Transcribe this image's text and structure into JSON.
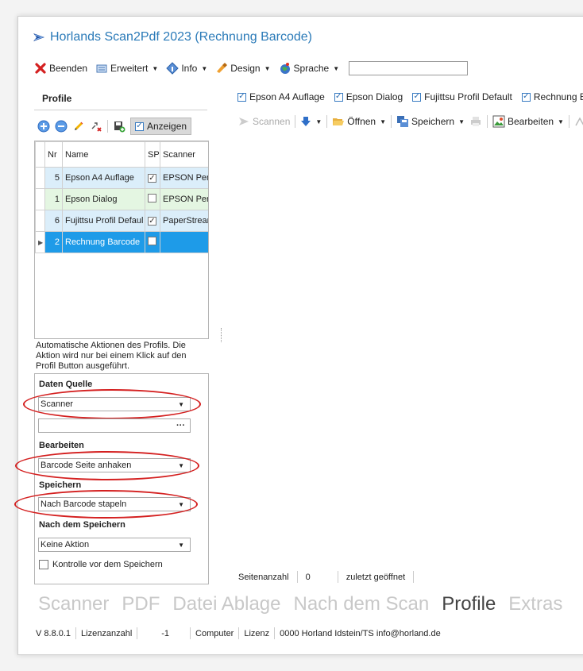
{
  "app": {
    "title": "Horlands Scan2Pdf 2023 (Rechnung Barcode)"
  },
  "menu": {
    "beenden": "Beenden",
    "erweitert": "Erweitert",
    "info": "Info",
    "design": "Design",
    "sprache": "Sprache",
    "search_value": ""
  },
  "sidebar": {
    "title": "Profile",
    "anzeigen": "Anzeigen",
    "grid": {
      "headers": [
        "Nr",
        "Name",
        "SP",
        "Scanner"
      ],
      "rows": [
        {
          "nr": "5",
          "name": "Epson A4 Auflage",
          "sp": true,
          "scanner": "EPSON Perf"
        },
        {
          "nr": "1",
          "name": "Epson Dialog",
          "sp": false,
          "scanner": "EPSON Perf"
        },
        {
          "nr": "6",
          "name": "Fujittsu Profil Defaul",
          "sp": true,
          "scanner": "PaperStrean"
        },
        {
          "nr": "2",
          "name": "Rechnung Barcode",
          "sp": false,
          "scanner": ""
        }
      ]
    },
    "description": "Automatische Aktionen des Profils. Die Aktion wird nur bei einem Klick auf den Profil Button ausgeführt.",
    "daten_quelle_label": "Daten Quelle",
    "daten_quelle_value": "Scanner",
    "path_value": "",
    "path_button": "···",
    "bearbeiten_label": "Bearbeiten",
    "bearbeiten_value": "Barcode Seite anhaken",
    "speichern_label": "Speichern",
    "speichern_value": "Nach Barcode stapeln",
    "nach_label": "Nach dem Speichern",
    "nach_value": "Keine Aktion",
    "kontrolle_label": "Kontrolle vor dem Speichern"
  },
  "profile_buttons": [
    "Epson A4 Auflage",
    "Epson Dialog",
    "Fujittsu Profil Default",
    "Rechnung B"
  ],
  "toolbar2": {
    "scannen": "Scannen",
    "oeffnen": "Öffnen",
    "speichern": "Speichern",
    "bearbeiten": "Bearbeiten"
  },
  "status": {
    "seitenanzahl_label": "Seitenanzahl",
    "seitenanzahl_value": "0",
    "zuletzt": "zuletzt geöffnet"
  },
  "tabs": [
    "Scanner",
    "PDF",
    "Datei Ablage",
    "Nach dem Scan",
    "Profile",
    "Extras"
  ],
  "active_tab": "Profile",
  "footer": {
    "version": "V 8.8.0.1",
    "lizenzanzahl_label": "Lizenzanzahl",
    "lizenzanzahl_value": "-1",
    "computer": "Computer",
    "lizenz": "Lizenz",
    "owner": "0000 Horland Idstein/TS info@horland.de"
  },
  "colors": {
    "title_blue": "#2a7ab8",
    "selected_row": "#1e9be8",
    "row_blue": "#dbeefa",
    "row_green": "#e4f6e2",
    "annotation_red": "#d42020"
  }
}
